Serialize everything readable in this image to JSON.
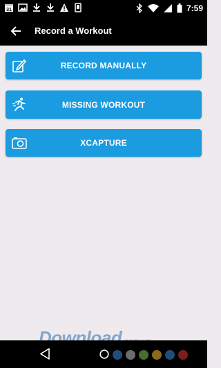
{
  "status_bar": {
    "left_icons": [
      "calendar-icon",
      "image-icon",
      "download-icon",
      "download-icon",
      "warning-icon",
      "vibrate-icon"
    ],
    "calendar_day": "31",
    "right_icons": [
      "bluetooth-icon",
      "wifi-icon",
      "signal-icon",
      "battery-icon"
    ],
    "time": "7:59"
  },
  "app_bar": {
    "title": "Record a Workout",
    "back_icon": "arrow-back-icon"
  },
  "actions": [
    {
      "label": "RECORD MANUALLY",
      "icon": "edit-icon"
    },
    {
      "label": "MISSING WORKOUT",
      "icon": "runner-icon"
    },
    {
      "label": "XCAPTURE",
      "icon": "camera-icon"
    }
  ],
  "colors": {
    "background": "#efeaed",
    "bar": "#000000",
    "button": "#1b9be0",
    "button_text": "#ffffff"
  },
  "nav_bar": {
    "icons": [
      "nav-back-icon",
      "nav-home-icon"
    ],
    "color_dots": [
      "#1f4e79",
      "#6b6b6b",
      "#4a6b2a",
      "#8a6a1a",
      "#1f4e79",
      "#7a1e1e"
    ]
  },
  "watermark": {
    "text": "Download",
    "suffix": ".com.vn"
  }
}
